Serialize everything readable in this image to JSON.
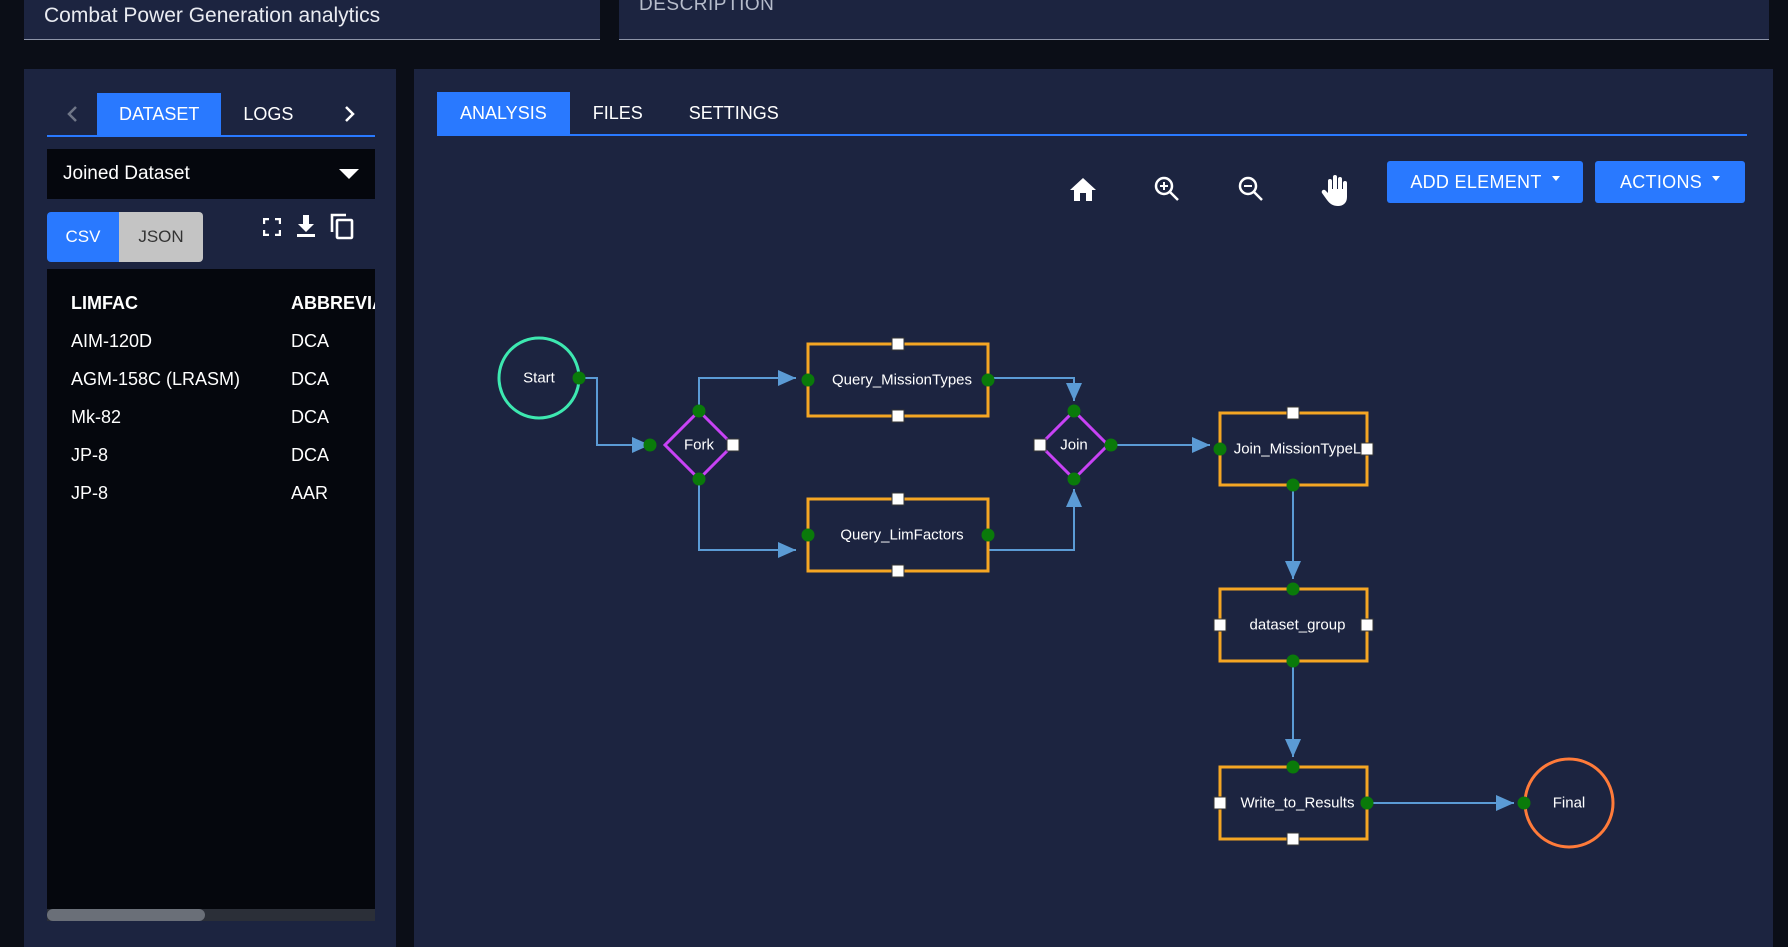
{
  "header": {
    "title_value": "Combat Power Generation analytics",
    "description_label": "DESCRIPTION"
  },
  "left_panel": {
    "tabs": [
      {
        "label": "DATASET",
        "active": true
      },
      {
        "label": "LOGS",
        "active": false
      }
    ],
    "dataset_select": {
      "value": "Joined Dataset"
    },
    "format_options": [
      {
        "label": "CSV",
        "active": true
      },
      {
        "label": "JSON",
        "active": false
      }
    ],
    "table": {
      "columns": [
        "LIMFAC",
        "ABBREVIA"
      ],
      "rows": [
        [
          "AIM-120D",
          "DCA"
        ],
        [
          "AGM-158C (LRASM)",
          "DCA"
        ],
        [
          "Mk-82",
          "DCA"
        ],
        [
          "JP-8",
          "DCA"
        ],
        [
          "JP-8",
          "AAR"
        ]
      ]
    }
  },
  "right_panel": {
    "tabs": [
      {
        "label": "ANALYSIS",
        "active": true
      },
      {
        "label": "FILES",
        "active": false
      },
      {
        "label": "SETTINGS",
        "active": false
      }
    ],
    "toolbar": {
      "add_element_label": "ADD ELEMENT",
      "actions_label": "ACTIONS"
    },
    "graph": {
      "nodes": [
        {
          "id": "start",
          "type": "start",
          "label": "Start"
        },
        {
          "id": "fork",
          "type": "gateway",
          "label": "Fork"
        },
        {
          "id": "q_mission",
          "type": "task",
          "label": "Query_MissionTypes"
        },
        {
          "id": "q_limf",
          "type": "task",
          "label": "Query_LimFactors"
        },
        {
          "id": "join",
          "type": "gateway",
          "label": "Join"
        },
        {
          "id": "join_mt",
          "type": "task",
          "label": "Join_MissionTypeL"
        },
        {
          "id": "dsgroup",
          "type": "task",
          "label": "dataset_group"
        },
        {
          "id": "write",
          "type": "task",
          "label": "Write_to_Results"
        },
        {
          "id": "final",
          "type": "end",
          "label": "Final"
        }
      ]
    },
    "colors": {
      "start": "#3de8b0",
      "end": "#ff7b3a",
      "task": "#f5a623",
      "gateway": "#c842f5",
      "edge": "#5b9bd5",
      "port_connected": "#0a7a0a",
      "accent": "#2979ff"
    }
  }
}
